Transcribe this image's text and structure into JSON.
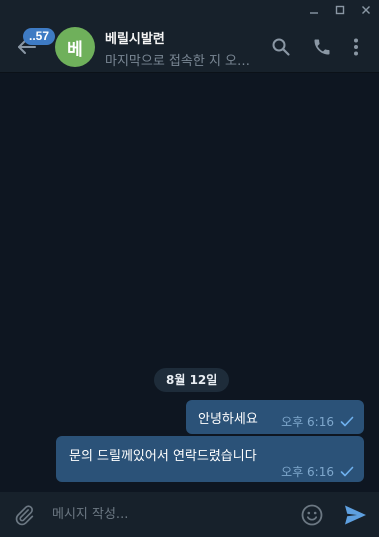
{
  "window": {
    "minimize_icon": "minimize-icon",
    "maximize_icon": "maximize-icon",
    "close_icon": "close-icon"
  },
  "header": {
    "unread_badge": "..57",
    "avatar_initial": "베",
    "avatar_color": "#6fb05b",
    "chat_name": "베릴시발련",
    "status": "마지막으로 접속한 지 오래됨",
    "icons": [
      "back-arrow-icon",
      "search-icon",
      "phone-icon",
      "more-vertical-icon"
    ]
  },
  "chat": {
    "date_label": "8월 12일",
    "messages": [
      {
        "text": "안녕하세요",
        "time": "오후 6:16",
        "status": "read"
      },
      {
        "text": "문의 드릴께있어서 연락드렸습니다",
        "time": "오후 6:16",
        "status": "read"
      }
    ]
  },
  "composer": {
    "placeholder": "메시지 작성...",
    "icons": [
      "paperclip-icon",
      "emoji-icon",
      "send-icon"
    ]
  },
  "colors": {
    "background": "#0e1621",
    "panel": "#17212b",
    "outgoing_bubble": "#2b5278",
    "accent": "#5ea0e0"
  }
}
